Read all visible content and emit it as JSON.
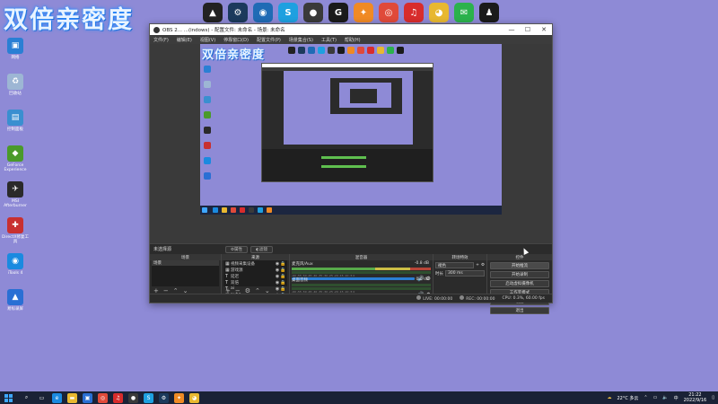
{
  "watermark": {
    "text": "双倍亲密度"
  },
  "top_icons": [
    {
      "name": "gamepad-icon",
      "glyph": "▲",
      "color": "#222222"
    },
    {
      "name": "steam-icon",
      "glyph": "⚙",
      "color": "#1b3a5c"
    },
    {
      "name": "app-circle-icon",
      "glyph": "◉",
      "color": "#1f6bb5"
    },
    {
      "name": "s-app-icon",
      "glyph": "S",
      "color": "#1ea0e0"
    },
    {
      "name": "obs-icon",
      "glyph": "●",
      "color": "#3a3a3a"
    },
    {
      "name": "logitech-g-icon",
      "glyph": "G",
      "color": "#1a1a1a"
    },
    {
      "name": "game-app-icon",
      "glyph": "✦",
      "color": "#f08a24"
    },
    {
      "name": "chrome-icon",
      "glyph": "◎",
      "color": "#e04a3a"
    },
    {
      "name": "netease-music-icon",
      "glyph": "♫",
      "color": "#d82c2c"
    },
    {
      "name": "owl-app-icon",
      "glyph": "◕",
      "color": "#e8b830"
    },
    {
      "name": "wechat-icon",
      "glyph": "✉",
      "color": "#2bb24c"
    },
    {
      "name": "qq-icon",
      "glyph": "♟",
      "color": "#1a1a1a"
    }
  ],
  "desktop_icons": [
    {
      "name": "desktop-icon-network",
      "label": "网络",
      "glyph": "▣",
      "color": "#2a7fd4"
    },
    {
      "name": "desktop-icon-recycle-bin",
      "label": "回收站",
      "glyph": "♻",
      "color": "#9db6d4"
    },
    {
      "name": "desktop-icon-control-panel",
      "label": "控制面板",
      "glyph": "▤",
      "color": "#3a8fd0"
    },
    {
      "name": "desktop-icon-geforce",
      "label": "GeForce Experience",
      "glyph": "◆",
      "color": "#4a9a2a"
    },
    {
      "name": "desktop-icon-msi-afterburner",
      "label": "MSI Afterburner",
      "glyph": "✈",
      "color": "#2a2a2a"
    },
    {
      "name": "desktop-icon-directx-repair",
      "label": "DirectX修复工具",
      "glyph": "✚",
      "color": "#c83030"
    },
    {
      "name": "desktop-icon-itools",
      "label": "iTools 4",
      "glyph": "◉",
      "color": "#1a8ae0"
    },
    {
      "name": "desktop-icon-recorder",
      "label": "易标录屏",
      "glyph": "▲",
      "color": "#2a6fd4"
    }
  ],
  "obs": {
    "title": "OBS 2... ...(indows) - 配置文件: 未命名 - 场景: 未命名",
    "menu": [
      "文件(F)",
      "编辑(E)",
      "视图(V)",
      "停靠窗口(D)",
      "配置文件(P)",
      "场景集合(S)",
      "工具(T)",
      "帮助(H)"
    ],
    "scene_bar_label": "未选择源",
    "scene_tabs": [
      "属性",
      "滤镜"
    ],
    "docks": {
      "scenes": {
        "title": "场景",
        "items": [
          "场景"
        ]
      },
      "sources": {
        "title": "来源",
        "items": [
          {
            "icon": "▦",
            "name": "视频采集设备"
          },
          {
            "icon": "▦",
            "name": "游戏源"
          },
          {
            "icon": "T",
            "name": "延迟"
          },
          {
            "icon": "T",
            "name": "双倍"
          },
          {
            "icon": "T",
            "name": "ai"
          },
          {
            "icon": "▦",
            "name": "pubg"
          }
        ]
      },
      "mixer": {
        "title": "混音器",
        "channels": [
          {
            "name": "麦克风/Aux",
            "db": "-0.8 dB"
          },
          {
            "name": "桌面音频",
            "db": "0.0 dB"
          }
        ],
        "scale": "-60 -55 -50 -45 -40 -35 -30 -25 -20 -15 -10 -5 0"
      },
      "transitions": {
        "title": "转场特效",
        "type": "褪色",
        "duration_label": "时长",
        "duration": "300 ms"
      },
      "controls": {
        "title": "控件",
        "buttons": [
          "开始推流",
          "开始录制",
          "启动虚拟摄像机",
          "工作室模式",
          "设置",
          "退出"
        ]
      }
    },
    "status": {
      "live": "LIVE: 00:00:00",
      "rec": "REC: 00:00:00",
      "cpu": "CPU: 0.3%, 60.00 fps"
    }
  },
  "taskbar": {
    "apps": [
      {
        "name": "taskbar-search-icon",
        "glyph": "⌕",
        "color": "#1a2236"
      },
      {
        "name": "taskbar-task-view-icon",
        "glyph": "▭",
        "color": "#1a2236"
      },
      {
        "name": "taskbar-edge-icon",
        "glyph": "e",
        "color": "#1a8ae0"
      },
      {
        "name": "taskbar-explorer-icon",
        "glyph": "▬",
        "color": "#e8b830"
      },
      {
        "name": "taskbar-store-icon",
        "glyph": "▣",
        "color": "#2a6fd4"
      },
      {
        "name": "taskbar-chrome-icon",
        "glyph": "◎",
        "color": "#e04a3a"
      },
      {
        "name": "taskbar-netease-icon",
        "glyph": "♫",
        "color": "#d82c2c"
      },
      {
        "name": "taskbar-obs-icon",
        "glyph": "●",
        "color": "#3a3a3a"
      },
      {
        "name": "taskbar-s-app-icon",
        "glyph": "S",
        "color": "#1ea0e0"
      },
      {
        "name": "taskbar-steam-icon",
        "glyph": "⚙",
        "color": "#1b3a5c"
      },
      {
        "name": "taskbar-game-icon",
        "glyph": "✦",
        "color": "#f08a24"
      },
      {
        "name": "taskbar-owl-icon",
        "glyph": "◕",
        "color": "#e8b830"
      }
    ],
    "weather": "22°C 多云",
    "time": "21:22",
    "date": "2022/9/16"
  }
}
